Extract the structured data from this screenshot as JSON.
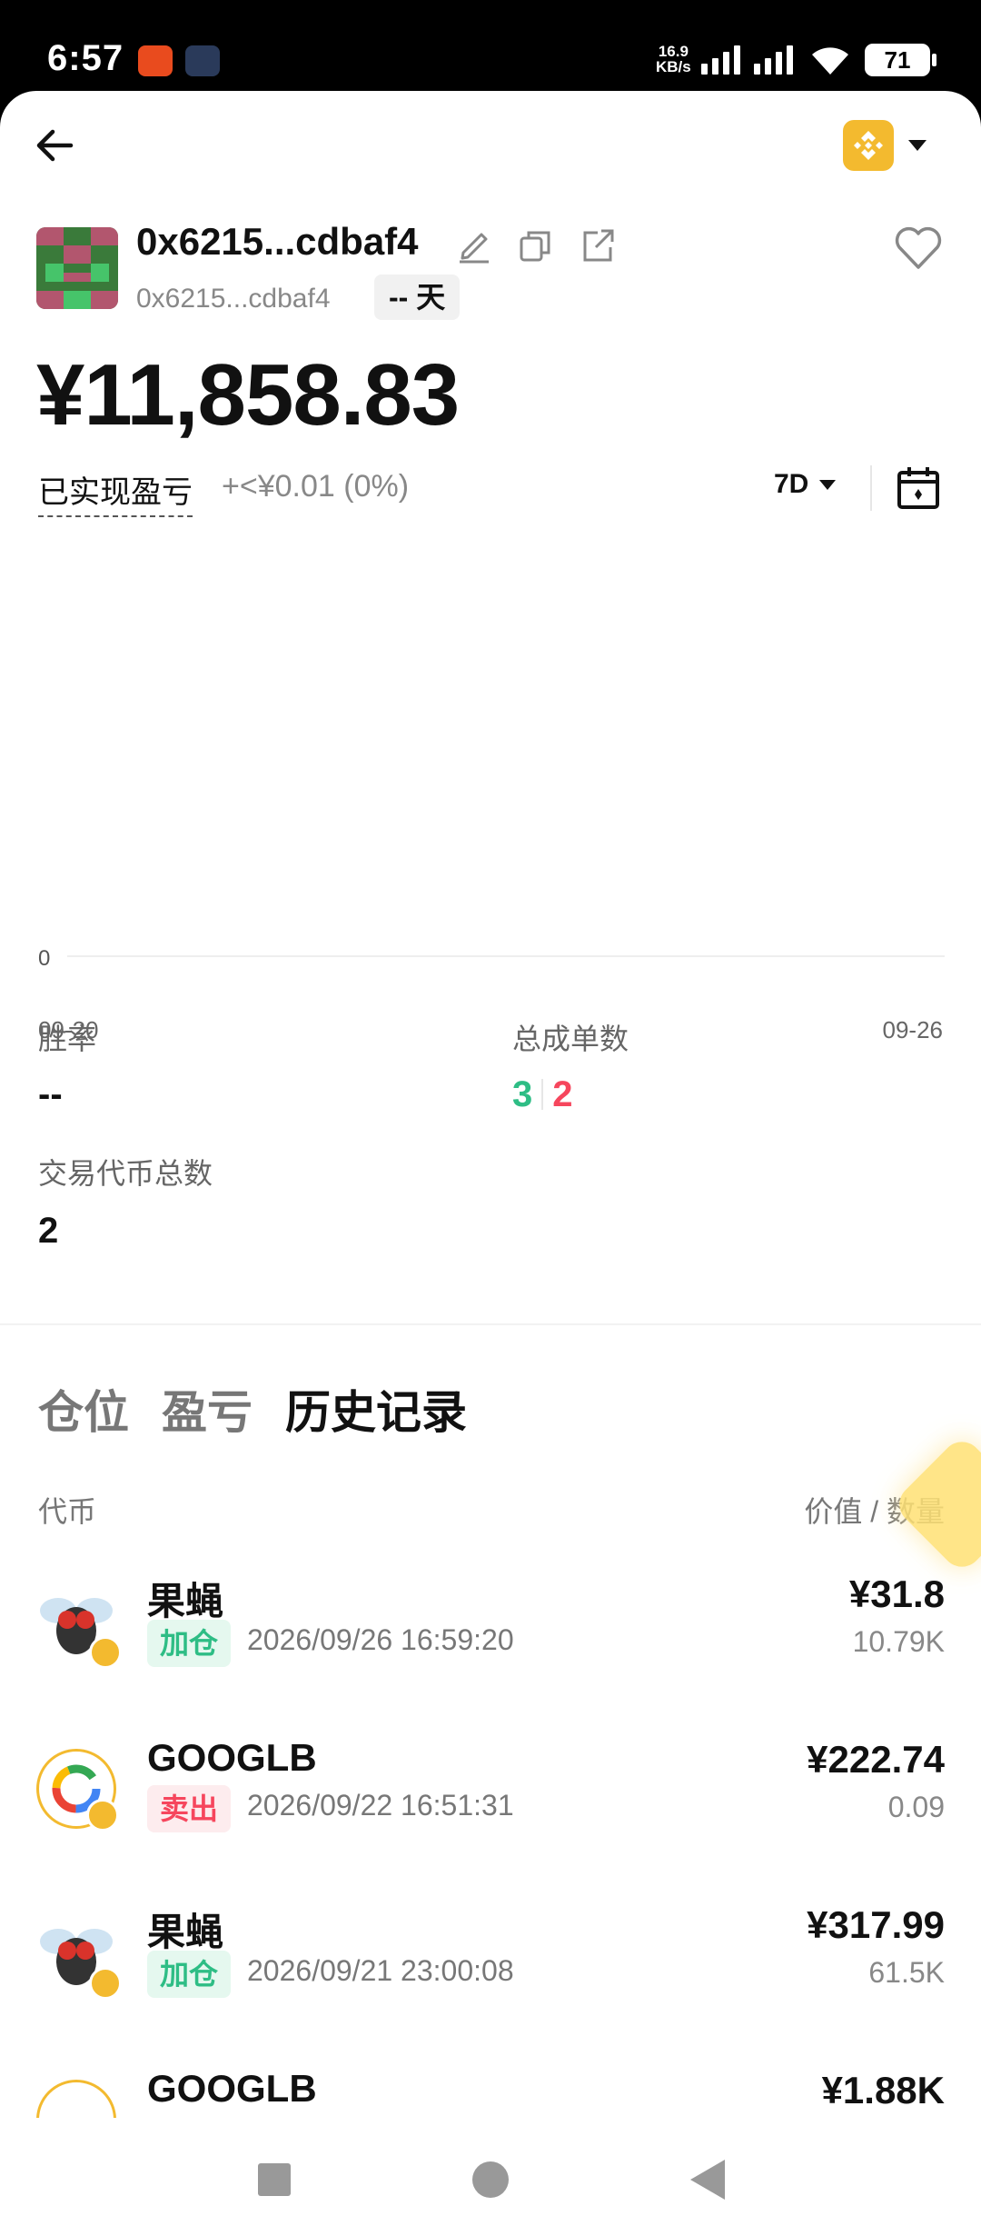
{
  "status_bar": {
    "time": "6:57",
    "net_speed_value": "16.9",
    "net_speed_unit": "KB/s",
    "battery": "71"
  },
  "header": {
    "chain_icon": "bnb-chain-icon",
    "back_icon": "arrow-left-icon"
  },
  "wallet": {
    "address": "0x6215...cdbaf4",
    "address_sub": "0x6215...cdbaf4",
    "days_badge": "-- 天",
    "balance": "¥11,858.83",
    "pnl_label": "已实现盈亏",
    "pnl_value": "+<¥0.01 (0%)",
    "period": "7D"
  },
  "chart_data": {
    "type": "line",
    "x": [
      "09-20",
      "09-26"
    ],
    "series": [],
    "ytick": "0",
    "xtick_start": "09-20",
    "xtick_end": "09-26",
    "grid": true
  },
  "stats": {
    "win_rate_label": "胜率",
    "win_rate_value": "--",
    "total_orders_label": "总成单数",
    "buy_orders": "3",
    "sell_orders": "2",
    "tokens_traded_label": "交易代币总数",
    "tokens_traded_value": "2"
  },
  "tabs": [
    {
      "label": "仓位",
      "active": false
    },
    {
      "label": "盈亏",
      "active": false
    },
    {
      "label": "历史记录",
      "active": true
    }
  ],
  "columns": {
    "left": "代币",
    "right": "价值 / 数量"
  },
  "history": [
    {
      "name": "果蝇",
      "icon": "fly-token-icon",
      "action": "加仓",
      "type": "buy",
      "time": "2026/09/26 16:59:20",
      "value": "¥31.8",
      "qty": "10.79K"
    },
    {
      "name": "GOOGLB",
      "icon": "google-token-icon",
      "action": "卖出",
      "type": "sell",
      "time": "2026/09/22 16:51:31",
      "value": "¥222.74",
      "qty": "0.09"
    },
    {
      "name": "果蝇",
      "icon": "fly-token-icon",
      "action": "加仓",
      "type": "buy",
      "time": "2026/09/21 23:00:08",
      "value": "¥317.99",
      "qty": "61.5K"
    },
    {
      "name": "GOOGLB",
      "icon": "google-token-icon",
      "action": "",
      "type": "sell",
      "time": "",
      "value": "¥1.88K",
      "qty": ""
    }
  ]
}
